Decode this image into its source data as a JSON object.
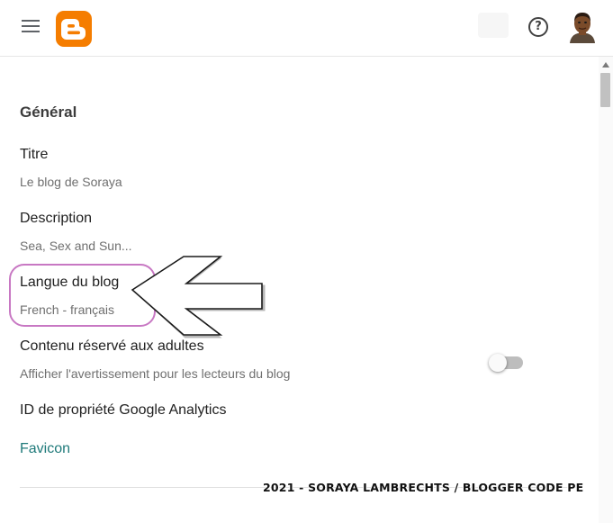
{
  "header": {
    "menu_icon": "hamburger-menu-icon",
    "logo_icon": "blogger-logo-icon",
    "help_icon": "help-icon",
    "help_glyph": "?",
    "avatar_icon": "user-avatar",
    "logo_color": "#f57d00"
  },
  "settings": {
    "section_title": "Général",
    "title_label": "Titre",
    "title_value": "Le blog de Soraya",
    "description_label": "Description",
    "description_value": "Sea, Sex and Sun...",
    "language_label": "Langue du blog",
    "language_value": "French - français",
    "adult_label": "Contenu réservé aux adultes",
    "adult_value": "Afficher l'avertissement pour les lecteurs du blog",
    "adult_toggle_on": false,
    "analytics_label": "ID de propriété Google Analytics",
    "favicon_label": "Favicon"
  },
  "annotations": {
    "highlight_color": "#c878c3",
    "arrow_icon": "left-arrow-annotation",
    "watermark": "2021 - SORAYA LAMBRECHTS / BLOGGER CODE PE"
  },
  "colors": {
    "link": "#1f7a7a",
    "toggle_off_track": "#bdbdbd"
  }
}
